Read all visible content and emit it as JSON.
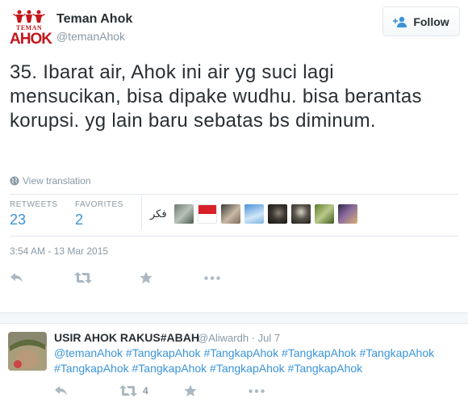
{
  "tweet": {
    "author_name": "Teman Ahok",
    "author_handle": "@temanAhok",
    "avatar": {
      "line1": "TEMAN",
      "line2": "AHOK"
    },
    "follow_label": "Follow",
    "text": "35. Ibarat air, Ahok ini air yg suci lagi mensucikan, bisa dipake wudhu. bisa berantas korupsi. yg lain baru sebatas bs diminum.",
    "view_translation": "View translation",
    "stats": {
      "retweets_label": "RETWEETS",
      "retweets_value": "23",
      "favorites_label": "FAVORITES",
      "favorites_value": "2"
    },
    "favoriter_label": "فكر",
    "timestamp": "3:54 AM - 13 Mar 2015"
  },
  "reply": {
    "author_name": "USIR AHOK RAKUS#ABAH",
    "meta": "@Aliwardh · Jul 7",
    "text_line1": "@temanAhok #TangkapAhok #TangkapAhok #TangkapAhok #TangkapAhok",
    "text_line2": "#TangkapAhok #TangkapAhok #TangkapAhok #TangkapAhok",
    "retweet_count": "4"
  },
  "colors": {
    "brand_red": "#c4161c",
    "link_blue": "#3b94d9",
    "muted": "#8899a6",
    "text": "#292f33"
  },
  "icons": [
    "globe-icon",
    "add-user-icon",
    "reply-icon",
    "retweet-icon",
    "favorite-star-icon",
    "more-dots-icon"
  ]
}
